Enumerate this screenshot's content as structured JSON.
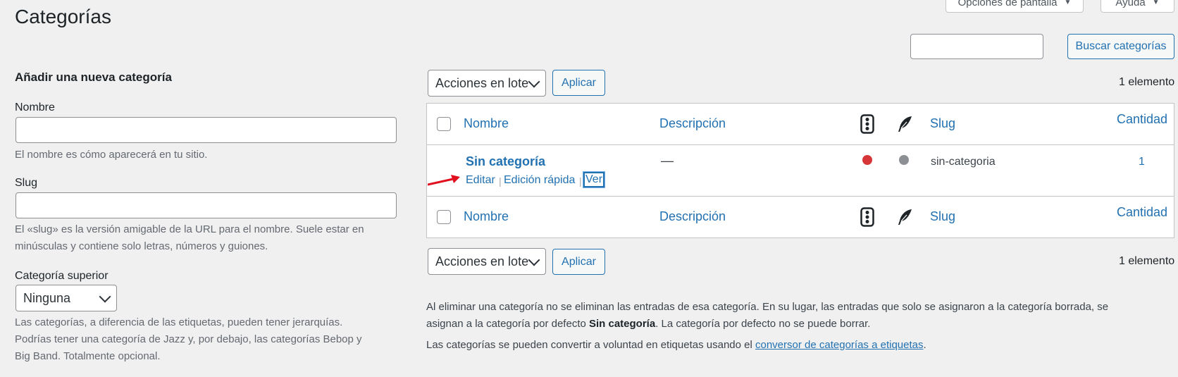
{
  "page": {
    "title": "Categorías",
    "screen_options_label": "Opciones de pantalla",
    "help_label": "Ayuda"
  },
  "search": {
    "placeholder": "",
    "button_label": "Buscar categorías"
  },
  "add_form": {
    "title": "Añadir una nueva categoría",
    "name_label": "Nombre",
    "name_value": "",
    "name_help": "El nombre es cómo aparecerá en tu sitio.",
    "slug_label": "Slug",
    "slug_value": "",
    "slug_help_line1": "El «slug» es la versión amigable de la URL para el nombre. Suele estar en",
    "slug_help_line2": "minúsculas y contiene solo letras, números y guiones.",
    "parent_label": "Categoría superior",
    "parent_selected": "Ninguna",
    "parent_help_line1": "Las categorías, a diferencia de las etiquetas, pueden tener jerarquías.",
    "parent_help_line2": "Podrías tener una categoría de Jazz y, por debajo, las categorías Bebop y",
    "parent_help_line3": "Big Band. Totalmente opcional."
  },
  "bulk": {
    "select_label": "Acciones en lote",
    "apply_label": "Aplicar",
    "count": "1 elemento"
  },
  "table": {
    "columns": {
      "name": "Nombre",
      "description": "Descripción",
      "seo_icon": "traffic-light-icon",
      "feather_icon": "feather-icon",
      "slug": "Slug",
      "count": "Cantidad"
    },
    "rows": [
      {
        "name": "Sin categoría",
        "description": "—",
        "status_color": "#d63638",
        "secondary_color": "#8c8f94",
        "slug": "sin-categoria",
        "count": "1",
        "actions": {
          "edit": "Editar",
          "quick_edit": "Edición rápida",
          "view": "Ver"
        }
      }
    ]
  },
  "info": {
    "line1": "Al eliminar una categoría no se eliminan las entradas de esa categoría. En su lugar, las entradas que solo se asignaron a la categoría borrada, se",
    "line2_pre": "asignan a la categoría por defecto ",
    "line2_bold": "Sin categoría",
    "line2_post": ". La categoría por defecto no se puede borrar.",
    "line3_pre": "Las categorías se pueden convertir a voluntad en etiquetas usando el ",
    "line3_link": "conversor de categorías a etiquetas",
    "line3_post": "."
  },
  "colors": {
    "accent": "#2271b1",
    "annotation_arrow": "#e0101e"
  }
}
